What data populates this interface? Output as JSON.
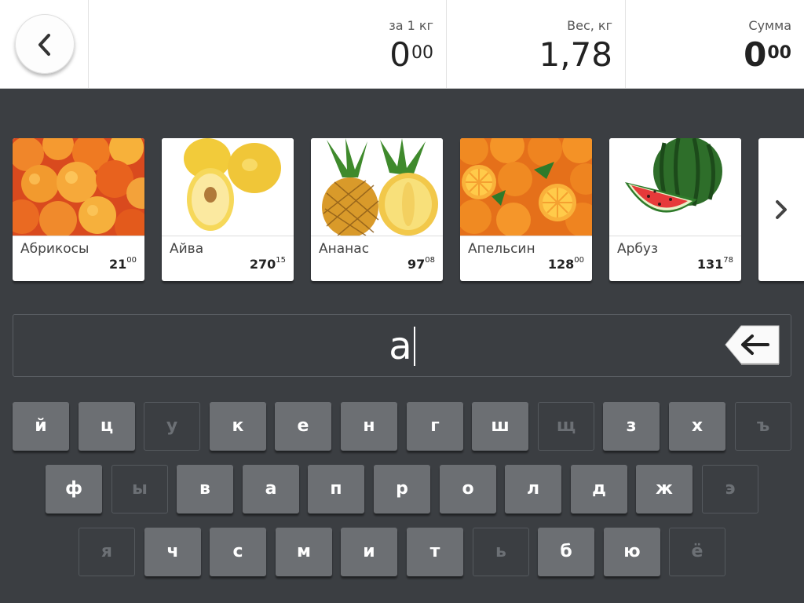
{
  "header": {
    "per_kg": {
      "label": "за 1 кг",
      "int": "0",
      "cents": "00"
    },
    "weight": {
      "label": "Вес, кг",
      "value": "1,78"
    },
    "sum": {
      "label": "Сумма",
      "int": "0",
      "cents": "00"
    }
  },
  "products": [
    {
      "name": "Абрикосы",
      "price_int": "21",
      "price_cents": "00",
      "image": "apricot-image"
    },
    {
      "name": "Айва",
      "price_int": "270",
      "price_cents": "15",
      "image": "quince-image"
    },
    {
      "name": "Ананас",
      "price_int": "97",
      "price_cents": "08",
      "image": "pineapple-image"
    },
    {
      "name": "Апельсин",
      "price_int": "128",
      "price_cents": "00",
      "image": "orange-image"
    },
    {
      "name": "Арбуз",
      "price_int": "131",
      "price_cents": "78",
      "image": "watermelon-image"
    }
  ],
  "search": {
    "value": "а"
  },
  "keyboard": {
    "row1": [
      {
        "label": "й",
        "enabled": true
      },
      {
        "label": "ц",
        "enabled": true
      },
      {
        "label": "у",
        "enabled": false
      },
      {
        "label": "к",
        "enabled": true
      },
      {
        "label": "е",
        "enabled": true
      },
      {
        "label": "н",
        "enabled": true
      },
      {
        "label": "г",
        "enabled": true
      },
      {
        "label": "ш",
        "enabled": true
      },
      {
        "label": "щ",
        "enabled": false
      },
      {
        "label": "з",
        "enabled": true
      },
      {
        "label": "х",
        "enabled": true
      },
      {
        "label": "ъ",
        "enabled": false
      }
    ],
    "row2": [
      {
        "label": "ф",
        "enabled": true
      },
      {
        "label": "ы",
        "enabled": false
      },
      {
        "label": "в",
        "enabled": true
      },
      {
        "label": "а",
        "enabled": true
      },
      {
        "label": "п",
        "enabled": true
      },
      {
        "label": "р",
        "enabled": true
      },
      {
        "label": "о",
        "enabled": true
      },
      {
        "label": "л",
        "enabled": true
      },
      {
        "label": "д",
        "enabled": true
      },
      {
        "label": "ж",
        "enabled": true
      },
      {
        "label": "э",
        "enabled": false
      }
    ],
    "row3": [
      {
        "label": "я",
        "enabled": false
      },
      {
        "label": "ч",
        "enabled": true
      },
      {
        "label": "с",
        "enabled": true
      },
      {
        "label": "м",
        "enabled": true
      },
      {
        "label": "и",
        "enabled": true
      },
      {
        "label": "т",
        "enabled": true
      },
      {
        "label": "ь",
        "enabled": false
      },
      {
        "label": "б",
        "enabled": true
      },
      {
        "label": "ю",
        "enabled": true
      },
      {
        "label": "ё",
        "enabled": false
      }
    ]
  },
  "icons": {
    "back": "chevron-left-icon",
    "next": "chevron-right-icon",
    "backspace": "backspace-icon"
  }
}
